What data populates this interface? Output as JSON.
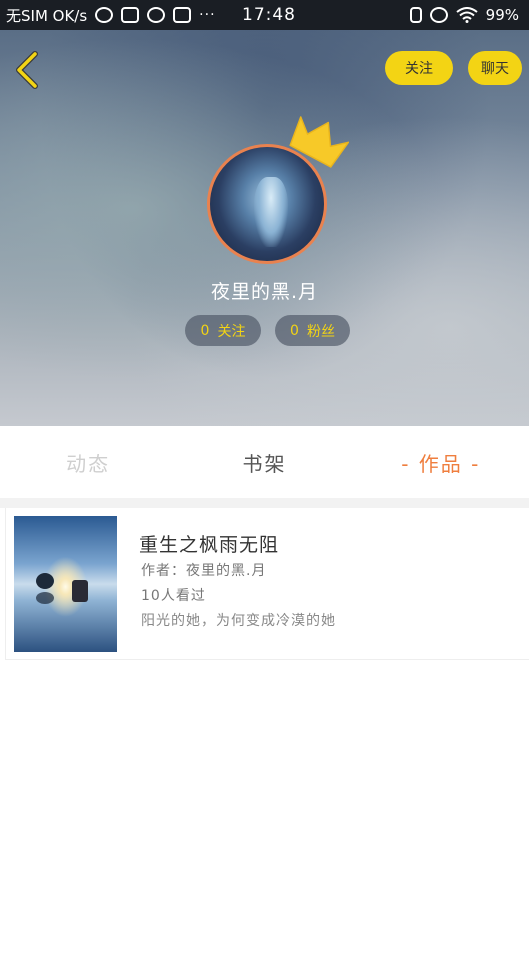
{
  "status_bar": {
    "carrier": "无SIM OK/s",
    "time": "17:48",
    "overflow": "···",
    "battery": "99%",
    "icons_left": [
      "qq-icon",
      "screenshot-icon",
      "shield-icon",
      "app-icon"
    ],
    "icons_right": [
      "vibrate-icon",
      "alarm-icon",
      "wifi-icon"
    ]
  },
  "header": {
    "follow_label": "关注",
    "chat_label": "聊天",
    "username": "夜里的黑.月",
    "following": {
      "count": "0",
      "label": "关注"
    },
    "fans": {
      "count": "0",
      "label": "粉丝"
    }
  },
  "tabs": [
    {
      "label": "动态"
    },
    {
      "label": "书架"
    },
    {
      "label": "- 作品 -"
    }
  ],
  "works": [
    {
      "title": "重生之枫雨无阻",
      "author": "作者：夜里的黑.月",
      "views": "10人看过",
      "description": "阳光的她，为何变成冷漠的她"
    }
  ],
  "colors": {
    "accent_yellow": "#f3d414",
    "accent_orange": "#ef7e3e",
    "avatar_border": "#e9824f"
  }
}
